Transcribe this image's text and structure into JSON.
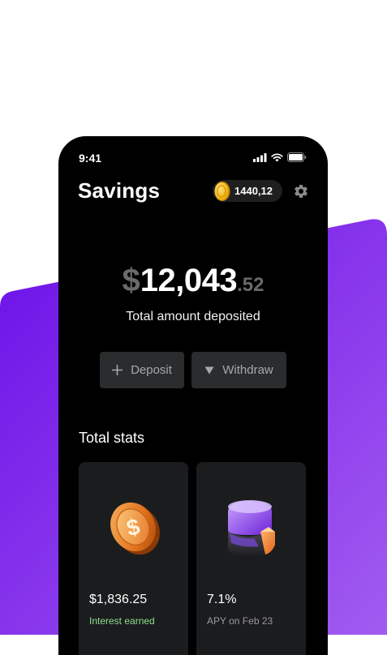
{
  "status_bar": {
    "time": "9:41",
    "icons": [
      "signal-icon",
      "wifi-icon",
      "battery-icon"
    ]
  },
  "header": {
    "title": "Savings",
    "coins": "1440,12",
    "coin_icon": "coin-icon",
    "settings_icon": "gear-icon"
  },
  "balance": {
    "currency": "$",
    "whole": "12,043",
    "decimal": ".52",
    "label": "Total amount deposited"
  },
  "actions": {
    "deposit": {
      "label": "Deposit",
      "icon": "plus-icon"
    },
    "withdraw": {
      "label": "Withdraw",
      "icon": "triangle-down-icon"
    }
  },
  "stats": {
    "title": "Total stats",
    "cards": [
      {
        "value": "$1,836.25",
        "label": "Interest earned",
        "icon": "dollar-coin-icon"
      },
      {
        "value": "7.1%",
        "label": "APY on Feb 23",
        "icon": "pie-chart-icon"
      }
    ]
  },
  "colors": {
    "accent_purple": "#7b23e6",
    "background": "#000000",
    "interest_green": "#8ee08e",
    "button_bg": "#2a2c2d"
  }
}
